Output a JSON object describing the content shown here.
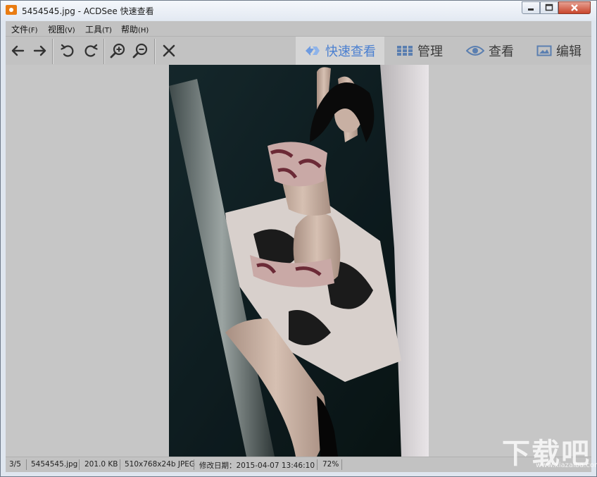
{
  "window": {
    "title": "5454545.jpg - ACDSee 快速查看"
  },
  "menu": {
    "items": [
      {
        "label": "文件",
        "accel": "(F)"
      },
      {
        "label": "视图",
        "accel": "(V)"
      },
      {
        "label": "工具",
        "accel": "(T)"
      },
      {
        "label": "帮助",
        "accel": "(H)"
      }
    ]
  },
  "toolbar": {
    "icons": [
      "arrow-left-icon",
      "arrow-right-icon",
      "rotate-left-icon",
      "rotate-right-icon",
      "zoom-in-icon",
      "zoom-out-icon",
      "close-x-icon"
    ]
  },
  "modes": {
    "quick_view": "快速查看",
    "manage": "管理",
    "view": "查看",
    "edit": "编辑",
    "active": "quick_view",
    "accent_color": "#4a7fd0"
  },
  "status": {
    "index": "3/5",
    "filename": "5454545.jpg",
    "filesize": "201.0 KB",
    "dimensions": "510x768x24b JPEG",
    "modified": "修改日期：2015-04-07 13:46:10",
    "zoom": "72%"
  },
  "watermark": {
    "text": "下载吧",
    "url": "www.xiazaiba.com"
  }
}
